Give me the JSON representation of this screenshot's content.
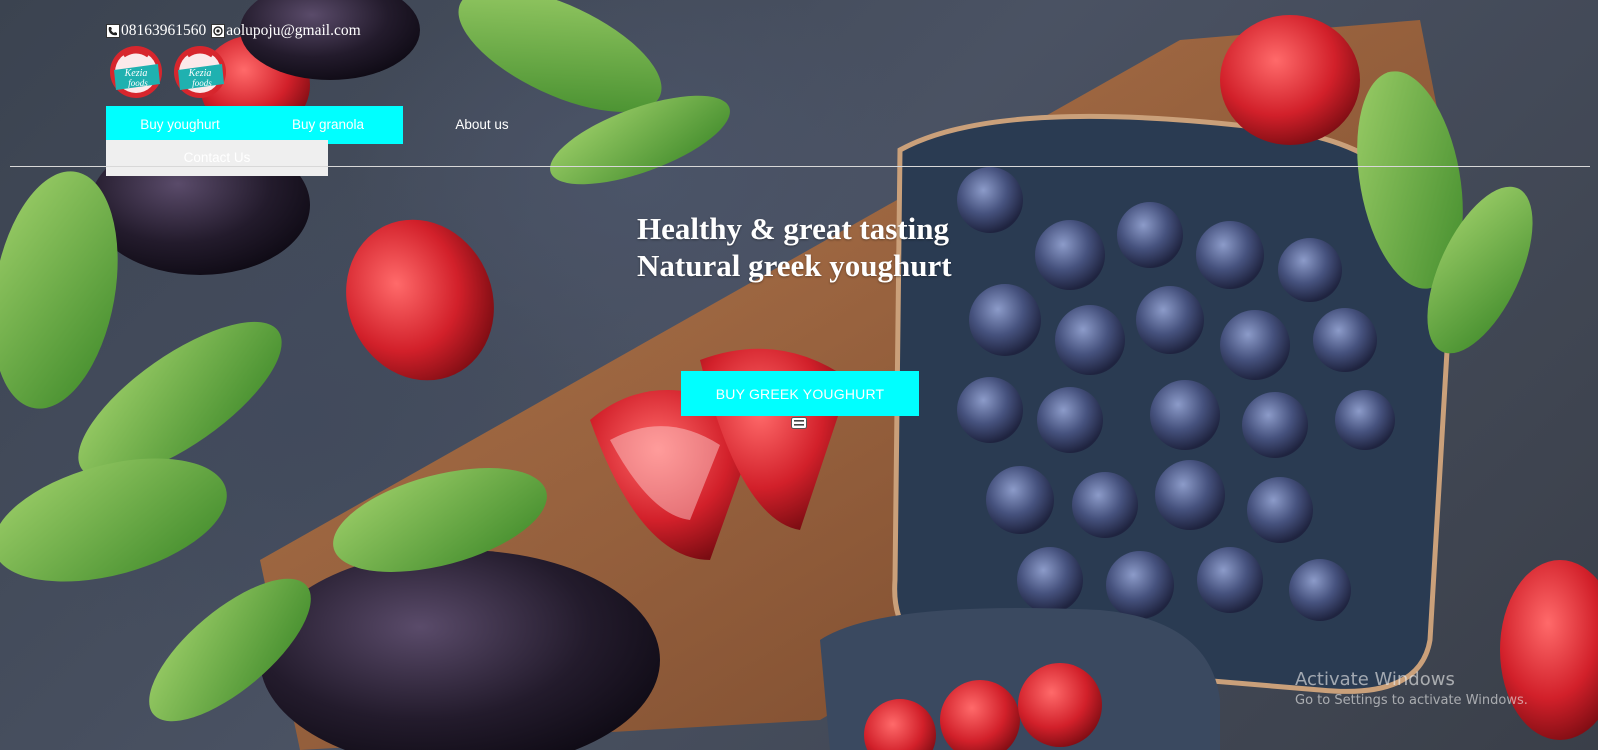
{
  "header": {
    "phone": "08163961560",
    "email": "aolupoju@gmail.com",
    "phone_icon": "phone-icon",
    "email_icon": "email-icon",
    "logo_text": "Kezia foods"
  },
  "nav": {
    "items": [
      {
        "label": "Buy youghurt"
      },
      {
        "label": "Buy granola"
      },
      {
        "label": "About us"
      },
      {
        "label": "Contact Us"
      }
    ]
  },
  "hero": {
    "title_line1": "Healthy & great tasting",
    "title_line2": "Natural greek youghurt",
    "cta_label": "BUY GREEK YOUGHURT",
    "toggle_icon": "hamburger-menu-icon"
  },
  "watermark": {
    "title": "Activate Windows",
    "subtitle": "Go to Settings to activate Windows."
  },
  "colors": {
    "accent": "#00ffff",
    "contact_bg": "#efefef",
    "text": "#ffffff"
  }
}
